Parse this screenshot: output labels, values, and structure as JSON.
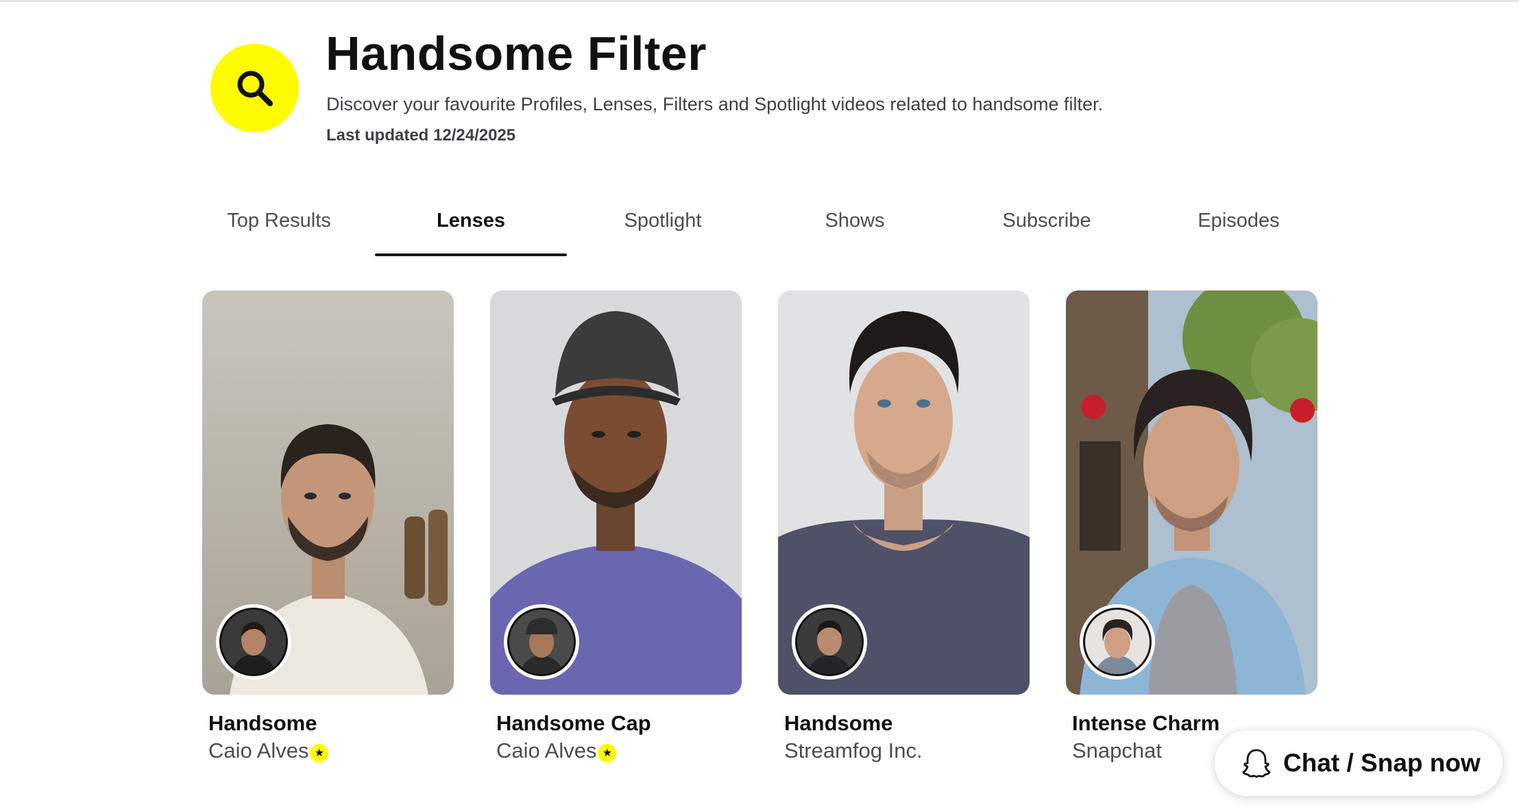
{
  "header": {
    "title": "Handsome Filter",
    "subtitle": "Discover your favourite Profiles, Lenses, Filters and Spotlight videos related to handsome filter.",
    "last_updated": "Last updated 12/24/2025",
    "badge_icon": "search-icon",
    "badge_color": "#fffc00"
  },
  "tabs": [
    {
      "label": "Top Results",
      "active": false
    },
    {
      "label": "Lenses",
      "active": true
    },
    {
      "label": "Spotlight",
      "active": false
    },
    {
      "label": "Shows",
      "active": false
    },
    {
      "label": "Subscribe",
      "active": false
    },
    {
      "label": "Episodes",
      "active": false
    }
  ],
  "lenses": [
    {
      "name": "Handsome",
      "creator": "Caio Alves",
      "verified": true
    },
    {
      "name": "Handsome Cap",
      "creator": "Caio Alves",
      "verified": true
    },
    {
      "name": "Handsome",
      "creator": "Streamfog Inc.",
      "verified": false
    },
    {
      "name": "Intense Charm",
      "creator": "Snapchat",
      "verified": false
    }
  ],
  "chat_button": {
    "label": "Chat / Snap now",
    "icon": "ghost-icon"
  }
}
